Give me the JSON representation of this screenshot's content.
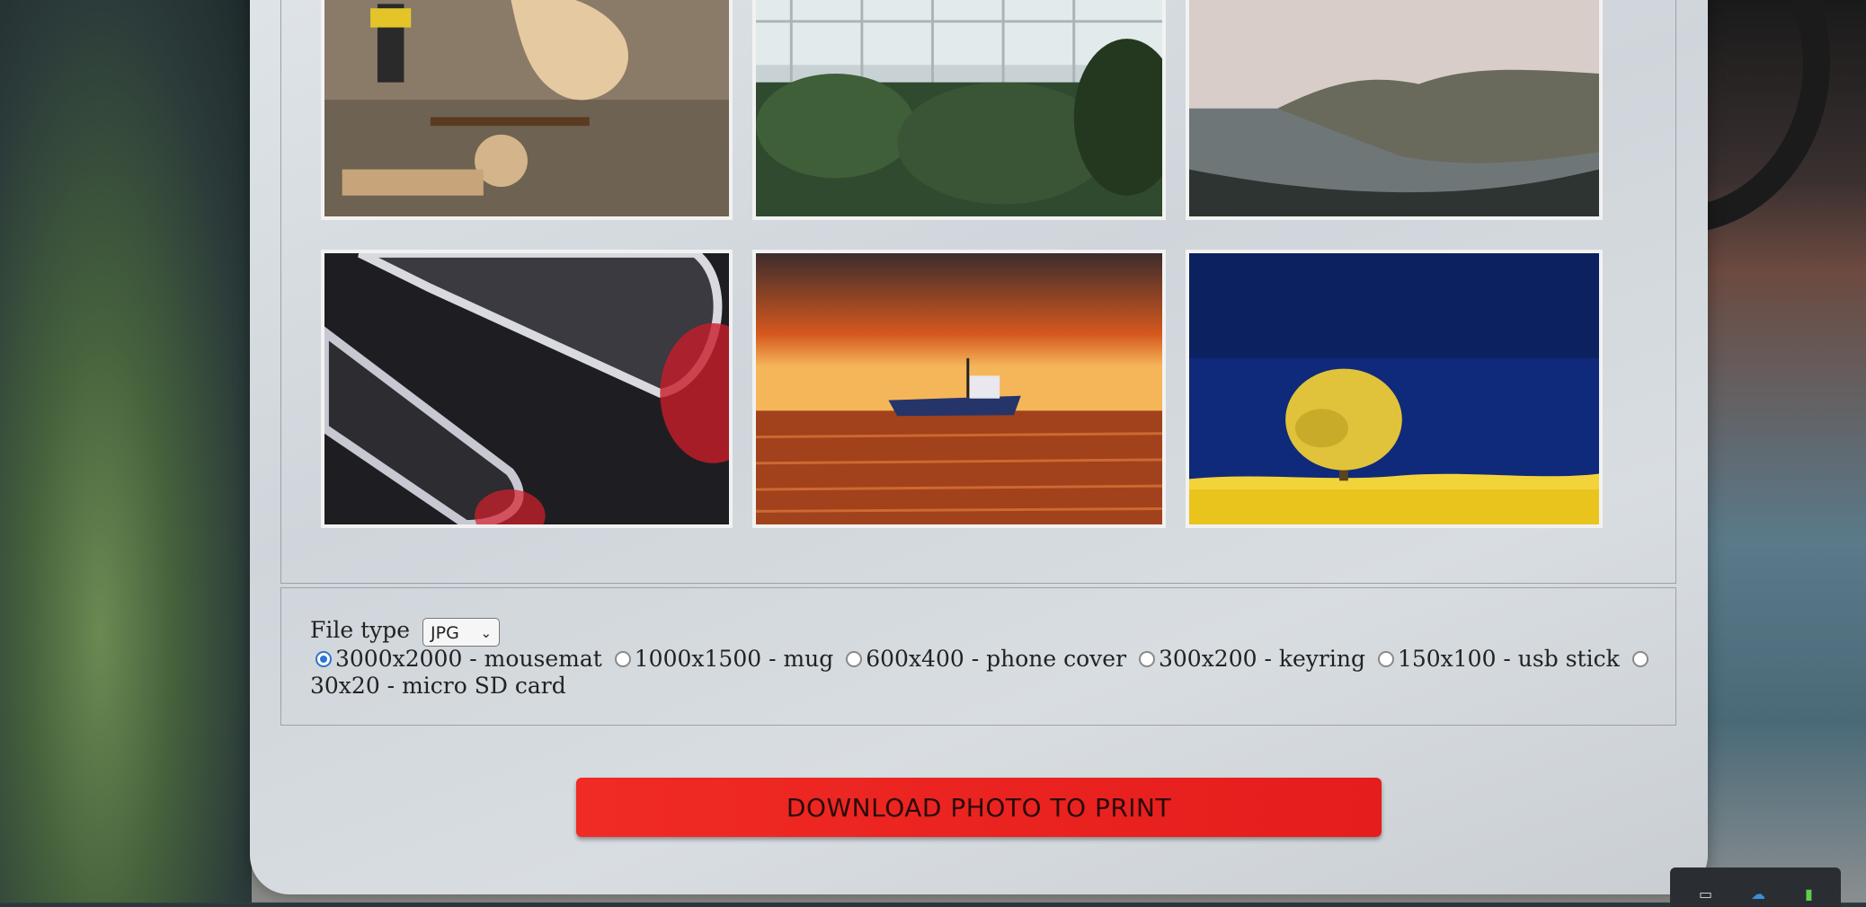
{
  "options": {
    "file_type_label": "File type",
    "file_type_value": "JPG",
    "sizes": [
      {
        "label": "3000x2000 - mousemat",
        "selected": true
      },
      {
        "label": "1000x1500 - mug",
        "selected": false
      },
      {
        "label": "600x400 - phone cover",
        "selected": false
      },
      {
        "label": "300x200 - keyring",
        "selected": false
      },
      {
        "label": "150x100 - usb stick",
        "selected": false
      },
      {
        "label": "30x20 - micro SD card",
        "selected": false
      }
    ]
  },
  "download_label": "DOWNLOAD PHOTO TO PRINT",
  "photos": [
    {
      "name": "woodworking-tools"
    },
    {
      "name": "greenhouse-palms"
    },
    {
      "name": "misty-coastline"
    },
    {
      "name": "red-chrome-abstract"
    },
    {
      "name": "boat-at-sunset"
    },
    {
      "name": "yellow-tree-blue-sky"
    }
  ],
  "colors": {
    "accent": "#e9221f",
    "radio_checked": "#2f74d0"
  },
  "tray_icons": [
    "usb-icon",
    "cloud-icon",
    "network-icon"
  ]
}
